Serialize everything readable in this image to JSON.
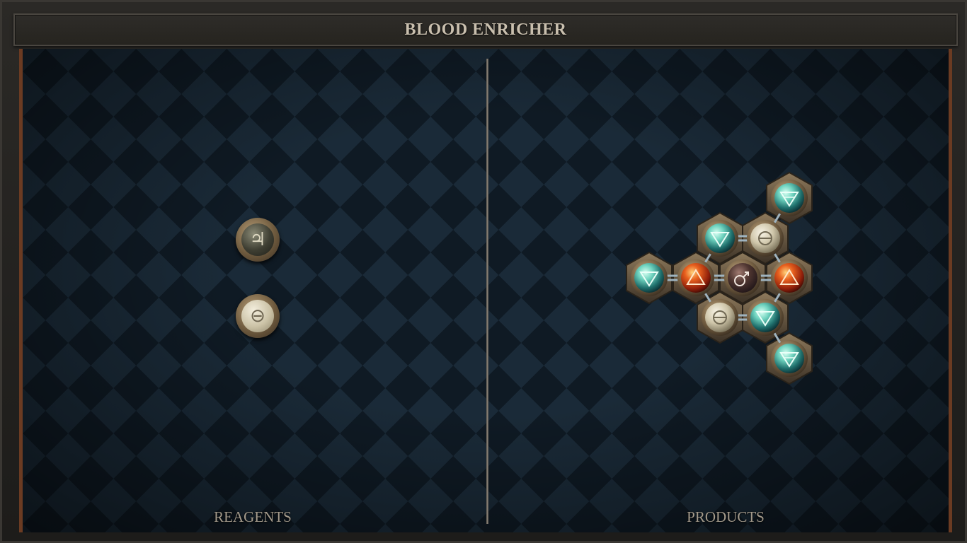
{
  "title": "BLOOD ENRICHER",
  "panels": {
    "reagents_label": "REAGENTS",
    "products_label": "PRODUCTS"
  },
  "reagents": [
    {
      "element": "tin",
      "glyph": "♃",
      "icon": "tin-atom-icon"
    },
    {
      "element": "salt",
      "glyph": "⊖",
      "icon": "salt-atom-icon"
    }
  ],
  "product_molecule": {
    "atoms": [
      {
        "id": "water-top",
        "element": "water",
        "glyph": "🜄"
      },
      {
        "id": "water-upper-left",
        "element": "water",
        "glyph": "🜄"
      },
      {
        "id": "salt-upper",
        "element": "salt",
        "glyph": "⊖"
      },
      {
        "id": "water-left",
        "element": "water",
        "glyph": "🜄"
      },
      {
        "id": "fire-left",
        "element": "fire",
        "glyph": "🜂"
      },
      {
        "id": "iron-center",
        "element": "iron",
        "glyph": "♂"
      },
      {
        "id": "fire-right",
        "element": "fire",
        "glyph": "🜂"
      },
      {
        "id": "salt-lower",
        "element": "salt",
        "glyph": "⊖"
      },
      {
        "id": "water-lower-right",
        "element": "water",
        "glyph": "🜄"
      },
      {
        "id": "water-bottom",
        "element": "water",
        "glyph": "🜄"
      }
    ]
  },
  "colors": {
    "water": "#4fb8a8",
    "fire": "#d2461e",
    "salt": "#d9d2bb",
    "iron": "#6a4a42",
    "tin": "#55554a",
    "frame_accent": "#6b3b22",
    "title_text": "#c9bfae",
    "label_text": "#a39a8b"
  }
}
